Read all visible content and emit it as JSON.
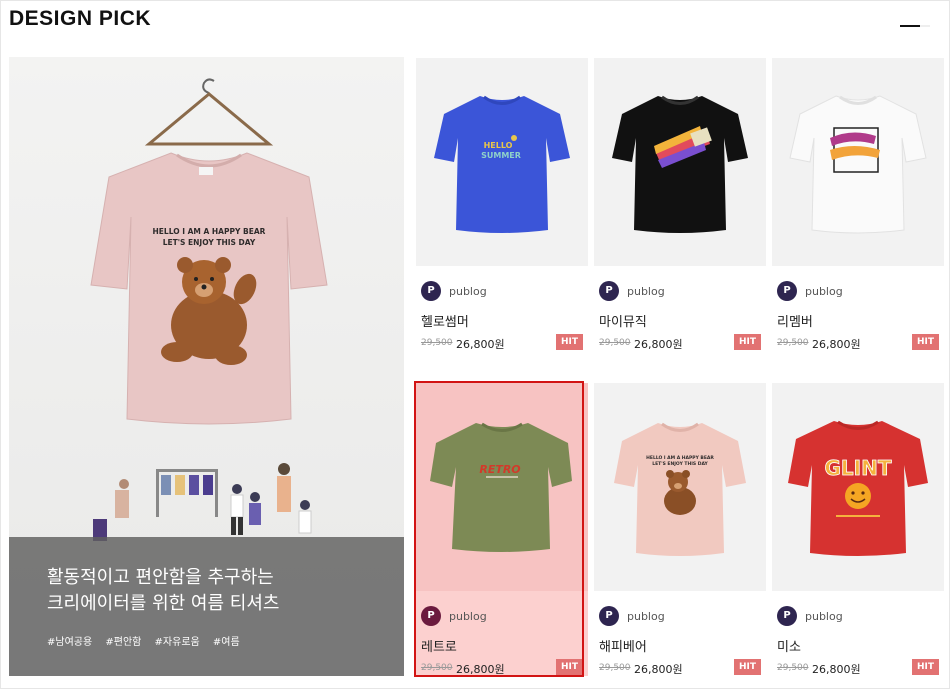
{
  "section": {
    "title": "DESIGN PICK"
  },
  "feature": {
    "headline_line1": "활동적이고 편안함을 추구하는",
    "headline_line2": "크리에이터를 위한 여름 티셔츠",
    "tags": [
      "#남여공용",
      "#편안함",
      "#자유로움",
      "#여름"
    ],
    "shirt_print_line1": "HELLO I AM A HAPPY BEAR",
    "shirt_print_line2": "LET'S ENJOY THIS DAY"
  },
  "products": [
    {
      "brand": "publog",
      "avatar": "P",
      "name": "헬로썸머",
      "original_price": "29,500",
      "price": "26,800원",
      "badge": "HIT",
      "shirt_color": "#3b55d8",
      "print": "HELLO SUMMER"
    },
    {
      "brand": "publog",
      "avatar": "P",
      "name": "마이뮤직",
      "original_price": "29,500",
      "price": "26,800원",
      "badge": "HIT",
      "shirt_color": "#111111",
      "print": ""
    },
    {
      "brand": "publog",
      "avatar": "P",
      "name": "리멤버",
      "original_price": "29,500",
      "price": "26,800원",
      "badge": "HIT",
      "shirt_color": "#fafafa",
      "print": ""
    },
    {
      "brand": "publog",
      "avatar": "P",
      "name": "레트로",
      "original_price": "29,500",
      "price": "26,800원",
      "badge": "HIT",
      "shirt_color": "#7d8a55",
      "print": "RETRO"
    },
    {
      "brand": "publog",
      "avatar": "P",
      "name": "해피베어",
      "original_price": "29,500",
      "price": "26,800원",
      "badge": "HIT",
      "shirt_color": "#f1c9c0",
      "print": "HELLO I AM A HAPPY BEAR"
    },
    {
      "brand": "publog",
      "avatar": "P",
      "name": "미소",
      "original_price": "29,500",
      "price": "26,800원",
      "badge": "HIT",
      "shirt_color": "#d63230",
      "print": "GLINT"
    }
  ],
  "colors": {
    "accent_selected": "#d21414",
    "badge": "#e27272",
    "avatar": "#2e2550"
  }
}
